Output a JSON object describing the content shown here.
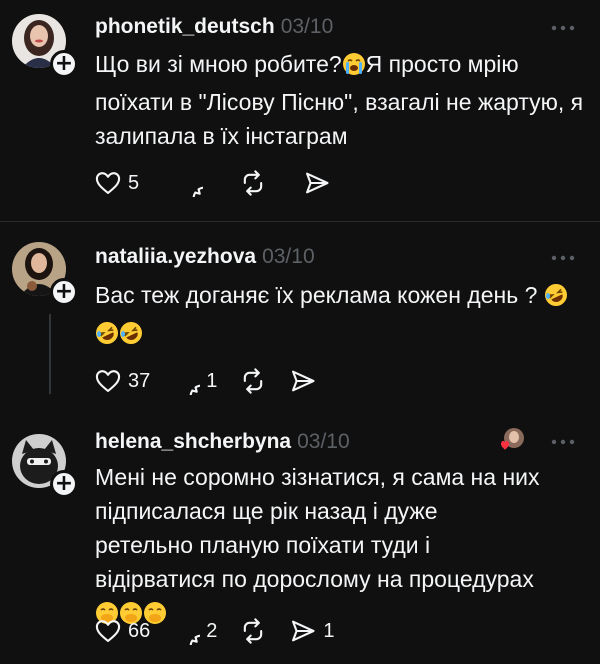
{
  "posts": [
    {
      "username": "phonetik_deutsch",
      "date": "03/10",
      "text_before": "Що ви зі мною робите?",
      "text_after": "Я просто мрію поїхати в \"Лісову Пісню\", взагалі не жартую, я залипала в їх інстаграм",
      "emoji_inline": "crying-face",
      "likes": "5",
      "replies": "",
      "reposts": "",
      "shares": ""
    },
    {
      "username": "nataliia.yezhova",
      "date": "03/10",
      "text_before": "Вас теж доганяє їх реклама кожен день ? ",
      "emoji_inline": "rofl-face",
      "likes": "37",
      "replies": "1",
      "reposts": "",
      "shares": ""
    },
    {
      "username": "helena_shcherbyna",
      "date": "03/10",
      "text_before": "Мені не соромно зізнатися, я сама на них підписалася ще рік назад і дуже ретельно планую поїхати туди і відірватися по дорослому на процедурах",
      "emoji_inline": "face-with-hand-over-mouth",
      "likes": "66",
      "replies": "2",
      "reposts": "",
      "shares": "1"
    }
  ],
  "colors": {
    "background": "#101010",
    "text": "#f3f5f7",
    "muted": "#5d6166",
    "divider": "#2a2a2a",
    "like_heart": "#ff3040"
  },
  "icons": [
    "heart-icon",
    "comment-icon",
    "repost-icon",
    "share-icon",
    "more-icon",
    "plus-icon"
  ]
}
